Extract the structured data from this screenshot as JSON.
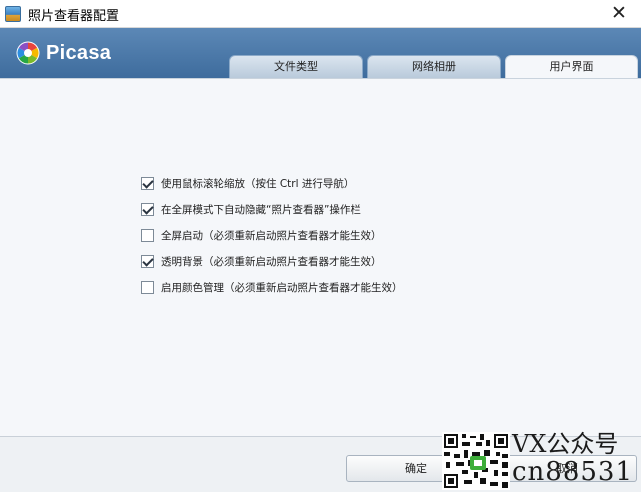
{
  "window": {
    "title": "照片查看器配置",
    "close_glyph": "✕"
  },
  "header": {
    "brand": "Picasa"
  },
  "tabs": [
    {
      "label": "文件类型",
      "active": false
    },
    {
      "label": "网络相册",
      "active": false
    },
    {
      "label": "用户界面",
      "active": true
    }
  ],
  "options": [
    {
      "label": "使用鼠标滚轮缩放（按住 Ctrl 进行导航）",
      "checked": true
    },
    {
      "label": "在全屏模式下自动隐藏“照片查看器”操作栏",
      "checked": true
    },
    {
      "label": "全屏启动（必须重新启动照片查看器才能生效）",
      "checked": false
    },
    {
      "label": "透明背景（必须重新启动照片查看器才能生效）",
      "checked": true
    },
    {
      "label": "启用颜色管理（必须重新启动照片查看器才能生效）",
      "checked": false
    }
  ],
  "footer": {
    "ok_label": "确定",
    "cancel_label": "取消"
  },
  "watermark": {
    "line1": "VX公众号",
    "line2": "cn88531"
  },
  "colors": {
    "header_top": "#5c88b6",
    "header_bottom": "#3e6c9d",
    "content_bg": "#f5f7fa"
  }
}
